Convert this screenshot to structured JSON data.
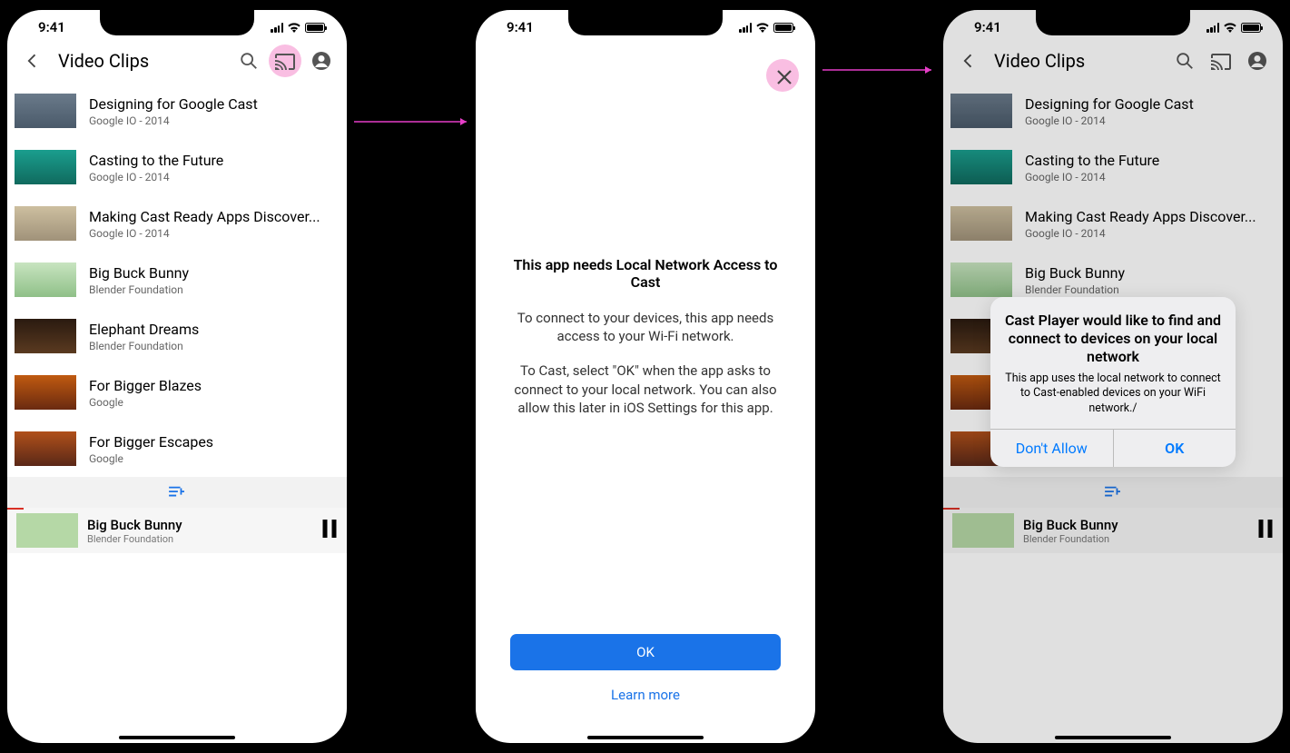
{
  "status": {
    "time": "9:41"
  },
  "header": {
    "title": "Video Clips"
  },
  "list": [
    {
      "title": "Designing for Google Cast",
      "sub": "Google IO - 2014"
    },
    {
      "title": "Casting to the Future",
      "sub": "Google IO - 2014"
    },
    {
      "title": "Making Cast Ready Apps Discover...",
      "sub": "Google IO - 2014"
    },
    {
      "title": "Big Buck Bunny",
      "sub": "Blender Foundation"
    },
    {
      "title": "Elephant Dreams",
      "sub": "Blender Foundation"
    },
    {
      "title": "For Bigger Blazes",
      "sub": "Google"
    },
    {
      "title": "For Bigger Escapes",
      "sub": "Google"
    }
  ],
  "nowplaying": {
    "title": "Big Buck Bunny",
    "sub": "Blender Foundation"
  },
  "modal": {
    "heading": "This app needs Local Network Access to Cast",
    "p1": "To connect to your devices, this app needs access to your Wi-Fi network.",
    "p2": "To Cast, select \"OK\" when the app asks to connect to your local network. You can also allow this later in iOS Settings for this app.",
    "ok": "OK",
    "learn": "Learn more"
  },
  "alert": {
    "title": "Cast Player would like to find and connect to devices on your local network",
    "desc": "This app uses the local network to connect to Cast-enabled devices on your WiFi network./",
    "deny": "Don't Allow",
    "allow": "OK"
  }
}
